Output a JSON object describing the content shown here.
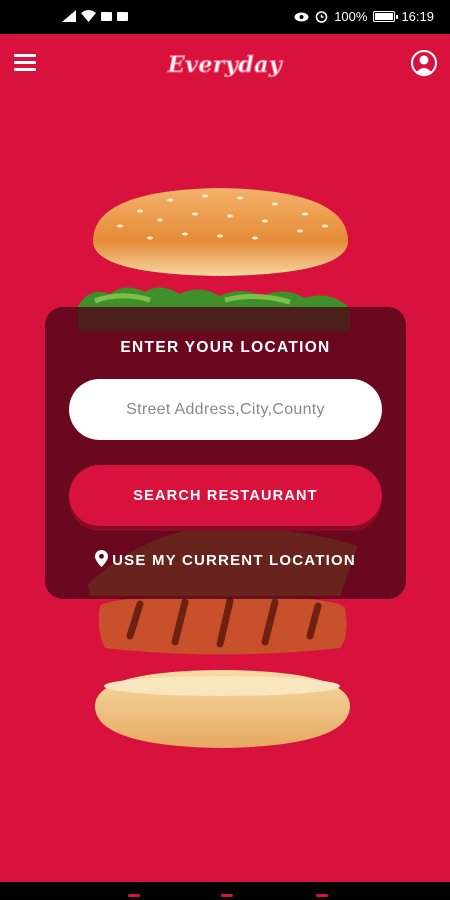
{
  "status_bar": {
    "battery": "100%",
    "time": "16:19"
  },
  "app_bar": {
    "logo_text": "Everyday",
    "menu_icon": "hamburger-menu-icon",
    "profile_icon": "user-profile-icon"
  },
  "search_card": {
    "title": "ENTER YOUR LOCATION",
    "address_placeholder": "Street Address,City,County",
    "address_value": "",
    "search_button": "SEARCH RESTAURANT",
    "current_location_link": "USE MY CURRENT LOCATION",
    "pin_icon": "location-pin-icon"
  },
  "colors": {
    "brand_red": "#d8123c",
    "card_overlay": "#500618",
    "text": "#ffffff"
  }
}
